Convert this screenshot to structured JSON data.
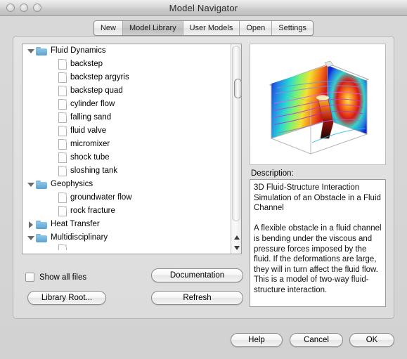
{
  "window": {
    "title": "Model Navigator",
    "traffic_lights": [
      "close-button",
      "minimize-button",
      "zoom-button"
    ]
  },
  "tabs": [
    {
      "label": "New",
      "selected": false
    },
    {
      "label": "Model Library",
      "selected": true
    },
    {
      "label": "User Models",
      "selected": false
    },
    {
      "label": "Open",
      "selected": false
    },
    {
      "label": "Settings",
      "selected": false
    }
  ],
  "tree": [
    {
      "label": "Fluid Dynamics",
      "type": "folder",
      "level": 1,
      "expanded": true
    },
    {
      "label": "backstep",
      "type": "file",
      "level": 2
    },
    {
      "label": "backstep argyris",
      "type": "file",
      "level": 2
    },
    {
      "label": "backstep quad",
      "type": "file",
      "level": 2
    },
    {
      "label": "cylinder flow",
      "type": "file",
      "level": 2
    },
    {
      "label": "falling sand",
      "type": "file",
      "level": 2
    },
    {
      "label": "fluid valve",
      "type": "file",
      "level": 2
    },
    {
      "label": "micromixer",
      "type": "file",
      "level": 2
    },
    {
      "label": "shock tube",
      "type": "file",
      "level": 2
    },
    {
      "label": "sloshing tank",
      "type": "file",
      "level": 2
    },
    {
      "label": "Geophysics",
      "type": "folder",
      "level": 1,
      "expanded": true
    },
    {
      "label": "groundwater flow",
      "type": "file",
      "level": 2
    },
    {
      "label": "rock fracture",
      "type": "file",
      "level": 2
    },
    {
      "label": "Heat Transfer",
      "type": "folder",
      "level": 1,
      "expanded": false
    },
    {
      "label": "Multidisciplinary",
      "type": "folder",
      "level": 1,
      "expanded": true
    }
  ],
  "scrollbar": {
    "up_arrow": "scroll-up-arrow",
    "down_arrow": "scroll-down-arrow"
  },
  "options": {
    "show_all_files_label": "Show all files",
    "show_all_files_checked": false
  },
  "buttons": {
    "library_root": "Library Root...",
    "documentation": "Documentation",
    "refresh": "Refresh",
    "help": "Help",
    "cancel": "Cancel",
    "ok": "OK"
  },
  "preview": {
    "icon_name": "model-preview-image",
    "alt": "3D fluid-structure interaction simulation rendering"
  },
  "description": {
    "label": "Description:",
    "text": "3D Fluid-Structure Interaction Simulation of an Obstacle in a Fluid Channel\n\nA flexible obstacle in a fluid channel is bending under the viscous and pressure forces imposed by the fluid. If the deformations are large, they will in turn affect the fluid flow. This is a model of two-way fluid-structure interaction."
  },
  "colors": {
    "window_bg": "#d8d8d8",
    "content_bg": "#e0e0e0",
    "list_bg": "#ffffff",
    "folder_blue": "#5ba3d0",
    "selected_tab": "#c4c4c4"
  }
}
